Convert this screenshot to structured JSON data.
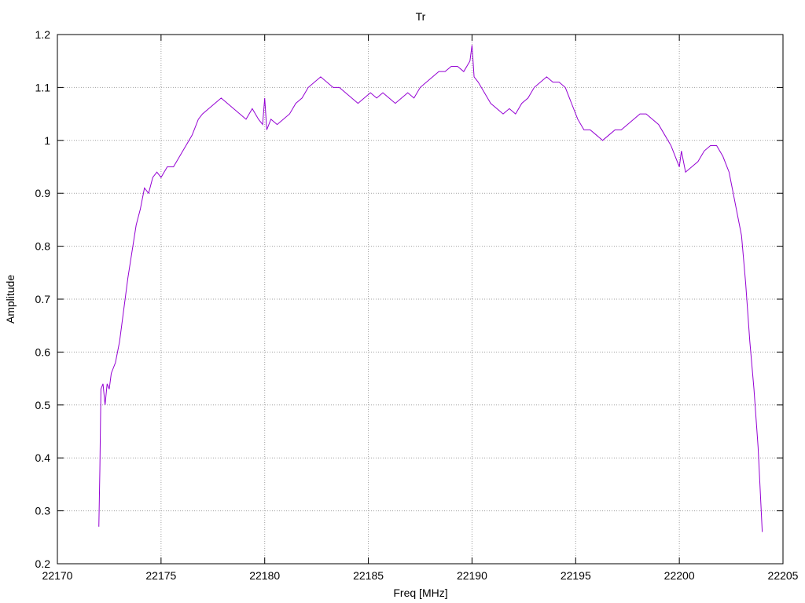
{
  "chart_data": {
    "type": "line",
    "title": "Tr",
    "xlabel": "Freq [MHz]",
    "ylabel": "Amplitude",
    "xlim": [
      22170,
      22205
    ],
    "ylim": [
      0.2,
      1.2
    ],
    "x_ticks": [
      22170,
      22175,
      22180,
      22185,
      22190,
      22195,
      22200,
      22205
    ],
    "y_ticks": [
      0.2,
      0.3,
      0.4,
      0.5,
      0.6,
      0.7,
      0.8,
      0.9,
      1,
      1.1,
      1.2
    ],
    "grid": true,
    "line_color": "#9400d3",
    "series": [
      {
        "x": [
          22172.0,
          22172.05,
          22172.1,
          22172.2,
          22172.3,
          22172.4,
          22172.5,
          22172.6,
          22172.8,
          22173.0,
          22173.2,
          22173.4,
          22173.6,
          22173.8,
          22174.0,
          22174.2,
          22174.4,
          22174.6,
          22174.8,
          22175.0,
          22175.3,
          22175.6,
          22175.9,
          22176.2,
          22176.5,
          22176.8,
          22177.0,
          22177.3,
          22177.6,
          22177.9,
          22178.2,
          22178.5,
          22178.8,
          22179.1,
          22179.4,
          22179.7,
          22179.9,
          22180.0,
          22180.1,
          22180.3,
          22180.6,
          22180.9,
          22181.2,
          22181.5,
          22181.8,
          22182.1,
          22182.4,
          22182.7,
          22183.0,
          22183.3,
          22183.6,
          22183.9,
          22184.2,
          22184.5,
          22184.8,
          22185.1,
          22185.4,
          22185.7,
          22186.0,
          22186.3,
          22186.6,
          22186.9,
          22187.2,
          22187.5,
          22187.8,
          22188.1,
          22188.4,
          22188.7,
          22189.0,
          22189.3,
          22189.6,
          22189.9,
          22190.0,
          22190.1,
          22190.3,
          22190.6,
          22190.9,
          22191.2,
          22191.5,
          22191.8,
          22192.1,
          22192.4,
          22192.7,
          22193.0,
          22193.3,
          22193.6,
          22193.9,
          22194.2,
          22194.5,
          22194.8,
          22195.1,
          22195.4,
          22195.7,
          22196.0,
          22196.3,
          22196.6,
          22196.9,
          22197.2,
          22197.5,
          22197.8,
          22198.1,
          22198.4,
          22198.7,
          22199.0,
          22199.3,
          22199.6,
          22199.9,
          22200.0,
          22200.1,
          22200.3,
          22200.6,
          22200.9,
          22201.2,
          22201.5,
          22201.8,
          22202.1,
          22202.4,
          22202.7,
          22203.0,
          22203.2,
          22203.4,
          22203.6,
          22203.8,
          22204.0
        ],
        "y": [
          0.27,
          0.38,
          0.53,
          0.54,
          0.5,
          0.54,
          0.53,
          0.56,
          0.58,
          0.62,
          0.68,
          0.74,
          0.79,
          0.84,
          0.87,
          0.91,
          0.9,
          0.93,
          0.94,
          0.93,
          0.95,
          0.95,
          0.97,
          0.99,
          1.01,
          1.04,
          1.05,
          1.06,
          1.07,
          1.08,
          1.07,
          1.06,
          1.05,
          1.04,
          1.06,
          1.04,
          1.03,
          1.08,
          1.02,
          1.04,
          1.03,
          1.04,
          1.05,
          1.07,
          1.08,
          1.1,
          1.11,
          1.12,
          1.11,
          1.1,
          1.1,
          1.09,
          1.08,
          1.07,
          1.08,
          1.09,
          1.08,
          1.09,
          1.08,
          1.07,
          1.08,
          1.09,
          1.08,
          1.1,
          1.11,
          1.12,
          1.13,
          1.13,
          1.14,
          1.14,
          1.13,
          1.15,
          1.18,
          1.12,
          1.11,
          1.09,
          1.07,
          1.06,
          1.05,
          1.06,
          1.05,
          1.07,
          1.08,
          1.1,
          1.11,
          1.12,
          1.11,
          1.11,
          1.1,
          1.07,
          1.04,
          1.02,
          1.02,
          1.01,
          1.0,
          1.01,
          1.02,
          1.02,
          1.03,
          1.04,
          1.05,
          1.05,
          1.04,
          1.03,
          1.01,
          0.99,
          0.96,
          0.95,
          0.98,
          0.94,
          0.95,
          0.96,
          0.98,
          0.99,
          0.99,
          0.97,
          0.94,
          0.88,
          0.82,
          0.73,
          0.62,
          0.53,
          0.42,
          0.26
        ]
      }
    ]
  }
}
